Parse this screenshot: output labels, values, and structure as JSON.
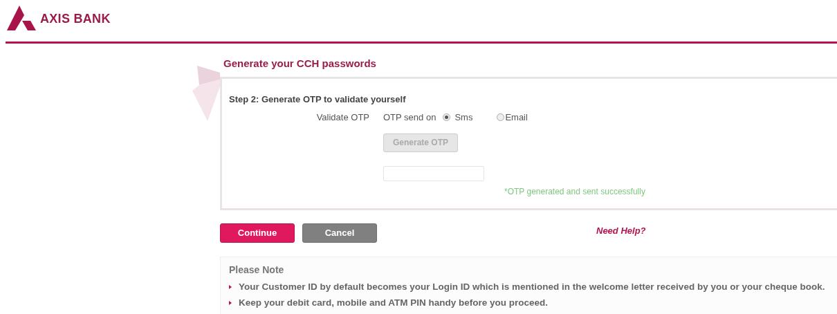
{
  "header": {
    "logo_text": "AXIS BANK"
  },
  "page_title": "Generate your CCH passwords",
  "form": {
    "step_title": "Step 2: Generate OTP to validate yourself",
    "field_label": "Validate OTP",
    "send_label": "OTP send on",
    "options": [
      {
        "label": "Sms",
        "selected": true
      },
      {
        "label": "Email",
        "selected": false
      }
    ],
    "generate_button": {
      "label": "Generate OTP",
      "disabled": true
    },
    "status_message": "*OTP generated and sent successfully"
  },
  "buttons": [
    {
      "label": "Continue",
      "kind": "primary"
    },
    {
      "label": "Cancel",
      "kind": "secondary"
    }
  ],
  "help_link": "Need Help?",
  "note": {
    "title": "Please Note",
    "items": [
      "Your Customer ID by default becomes your Login ID which is mentioned in the welcome letter received by you or your cheque book.",
      "Keep your debit card, mobile and ATM PIN handy before you proceed."
    ]
  }
}
